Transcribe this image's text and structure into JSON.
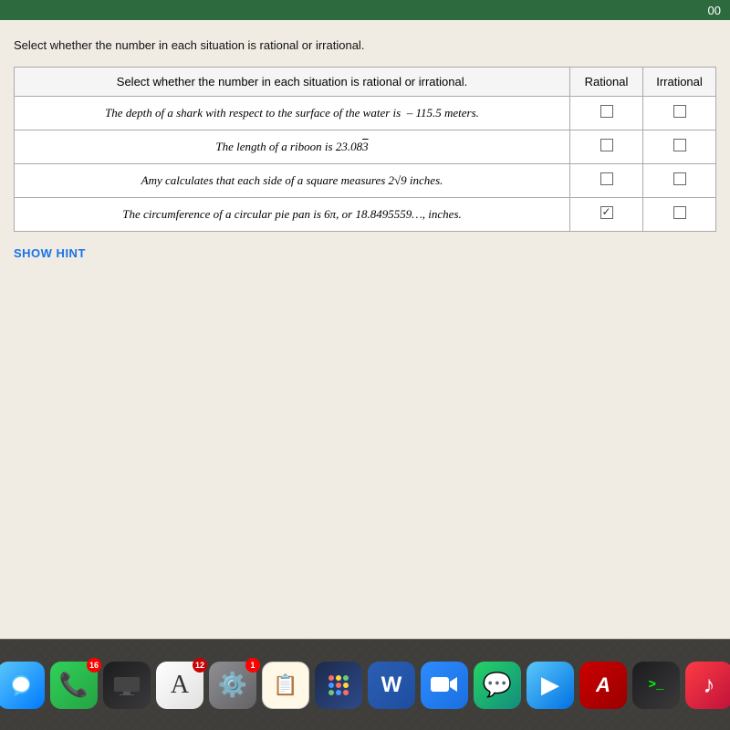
{
  "topbar": {
    "time": "00"
  },
  "page": {
    "instruction": "Select whether the number in each situation is rational or irrational."
  },
  "table": {
    "headers": {
      "description": "Select whether the number in each situation is rational or irrational.",
      "rational": "Rational",
      "irrational": "Irrational"
    },
    "rows": [
      {
        "id": "row1",
        "description_html": "The depth of a <em>a</em> shark with respect to the surface of the water is – 115.5 meters.",
        "description": "The depth of a shark with respect to the surface of the water is – 115.5 meters.",
        "rational_checked": false,
        "irrational_checked": false
      },
      {
        "id": "row2",
        "description": "The length of a riboon is 23.083̄",
        "rational_checked": false,
        "irrational_checked": false
      },
      {
        "id": "row3",
        "description": "Amy calculates that each side of a square measures 2√9 inches.",
        "rational_checked": false,
        "irrational_checked": false
      },
      {
        "id": "row4",
        "description": "The circumference of a circular pie pan is 6π, or 18.8495559…, inches.",
        "rational_checked": true,
        "irrational_checked": false
      }
    ]
  },
  "show_hint": {
    "label": "SHOW HINT"
  },
  "dock": {
    "items": [
      {
        "id": "messages",
        "label": "Messages",
        "icon": "💬",
        "class": "icon-messages",
        "badge": null
      },
      {
        "id": "facetime",
        "label": "FaceTime",
        "icon": "📷",
        "class": "icon-facetime",
        "badge": "16"
      },
      {
        "id": "appletv",
        "label": "Apple TV",
        "icon": "📺",
        "class": "icon-appletv",
        "badge": null
      },
      {
        "id": "fontbook",
        "label": "Font Book",
        "icon": "A",
        "class": "icon-fontbook",
        "badge": "12"
      },
      {
        "id": "settings",
        "label": "Settings",
        "icon": "⚙️",
        "class": "icon-settings",
        "badge": "1"
      },
      {
        "id": "reminders",
        "label": "Reminders",
        "icon": "🔲",
        "class": "icon-reminders",
        "badge": null
      },
      {
        "id": "launchpad",
        "label": "Launchpad",
        "icon": "🚀",
        "class": "icon-launchpad",
        "badge": null
      },
      {
        "id": "word",
        "label": "Word",
        "icon": "W",
        "class": "icon-word",
        "badge": null
      },
      {
        "id": "zoom",
        "label": "Zoom",
        "icon": "📹",
        "class": "icon-zoom",
        "badge": null
      },
      {
        "id": "whatsapp",
        "label": "WhatsApp",
        "icon": "📱",
        "class": "icon-whatsapp",
        "badge": null
      },
      {
        "id": "imovie",
        "label": "iMovie",
        "icon": "▶",
        "class": "icon-imovie",
        "badge": null
      },
      {
        "id": "acrobat",
        "label": "Acrobat",
        "icon": "A",
        "class": "icon-acrobat",
        "badge": null
      },
      {
        "id": "terminal",
        "label": "Terminal",
        "icon": ">_",
        "class": "icon-terminal",
        "badge": null
      },
      {
        "id": "music",
        "label": "Music",
        "icon": "♪",
        "class": "icon-music",
        "badge": null
      }
    ]
  }
}
